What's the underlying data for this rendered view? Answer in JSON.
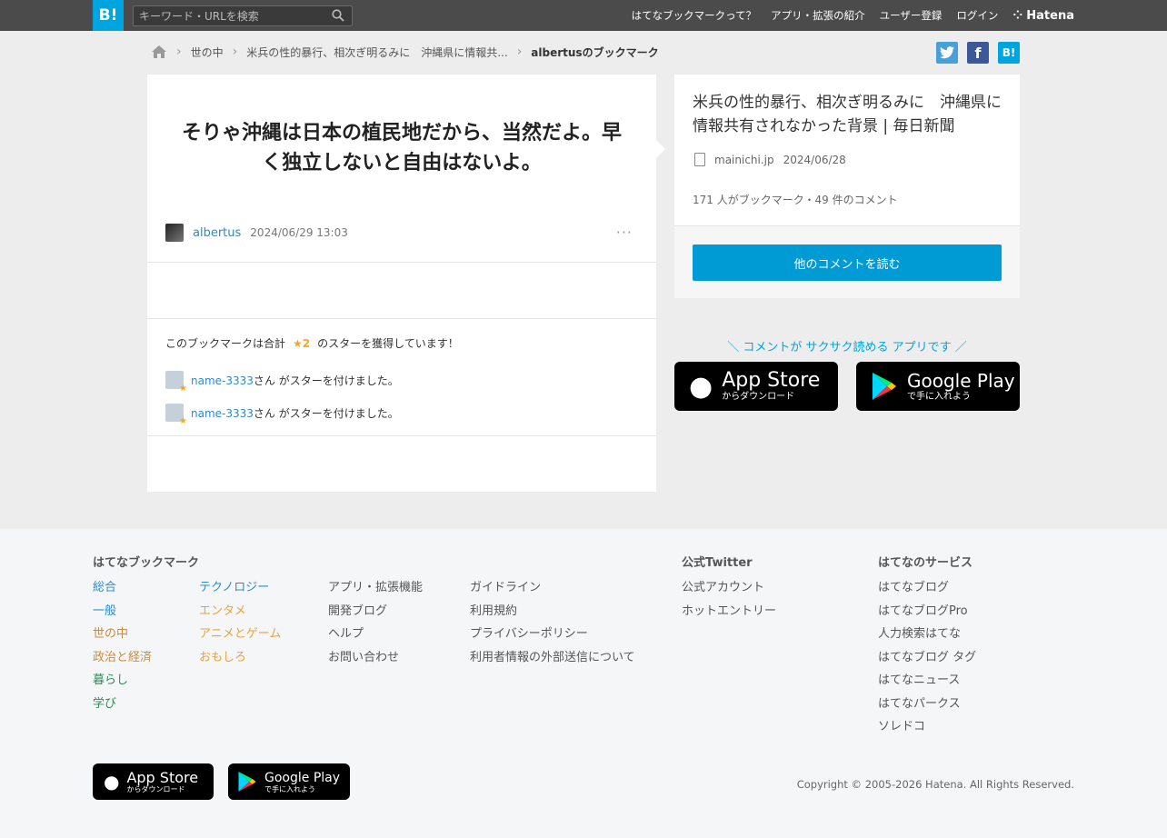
{
  "header": {
    "logo": "B!",
    "search_placeholder": "キーワード・URLを検索",
    "nav": [
      "はてなブックマークって？",
      "アプリ・拡張の紹介",
      "ユーザー登録",
      "ログイン"
    ],
    "brand": "Hatena"
  },
  "breadcrumb": {
    "category": "世の中",
    "entry": "米兵の性的暴行、相次ぎ明るみに　沖縄県に情報共...",
    "current": "albertusのブックマーク"
  },
  "share": {
    "twitter": "t",
    "facebook": "f",
    "hatena": "B!"
  },
  "bookmark": {
    "comment": "そりゃ沖縄は日本の植民地だから、当然だよ。早く独立しないと自由はないよ。",
    "user": "albertus",
    "datetime": "2024/06/29 13:03",
    "more": "···"
  },
  "stars": {
    "summary_pre": "このブックマークは合計",
    "count": "★2",
    "summary_post": "のスターを獲得しています！",
    "entries": [
      {
        "name": "name-3333",
        "text": "さん がスターを付けました。"
      },
      {
        "name": "name-3333",
        "text": "さん がスターを付けました。"
      }
    ]
  },
  "entry": {
    "title": "米兵の性的暴行、相次ぎ明るみに　沖縄県に情報共有されなかった背景 | 毎日新聞",
    "domain": "mainichi.jp",
    "date": "2024/06/28",
    "count": "171 人がブックマーク・49 件のコメント",
    "read_button": "他のコメントを読む"
  },
  "app_promo": {
    "message": "＼ コメントが サクサク読める アプリです ／",
    "appstore_big": "App Store",
    "appstore_small": "からダウンロード",
    "googleplay_big": "Google Play",
    "googleplay_small": "で手に入れよう"
  },
  "footer": {
    "heading_bookmark": "はてなブックマーク",
    "col1": [
      "総合",
      "一般",
      "世の中",
      "政治と経済",
      "暮らし",
      "学び"
    ],
    "col2": [
      "テクノロジー",
      "エンタメ",
      "アニメとゲーム",
      "おもしろ"
    ],
    "col3": [
      "アプリ・拡張機能",
      "開発ブログ",
      "ヘルプ",
      "お問い合わせ"
    ],
    "col4": [
      "ガイドライン",
      "利用規約",
      "プライバシーポリシー",
      "利用者情報の外部送信について"
    ],
    "heading_twitter": "公式Twitter",
    "twitter": [
      "公式アカウント",
      "ホットエントリー"
    ],
    "heading_services": "はてなのサービス",
    "services": [
      "はてなブログ",
      "はてなブログPro",
      "人力検索はてな",
      "はてなブログ タグ",
      "はてなニュース",
      "はてなパークス",
      "ソレドコ"
    ],
    "copyright": "Copyright © 2005-2026 Hatena. All Rights Reserved."
  }
}
